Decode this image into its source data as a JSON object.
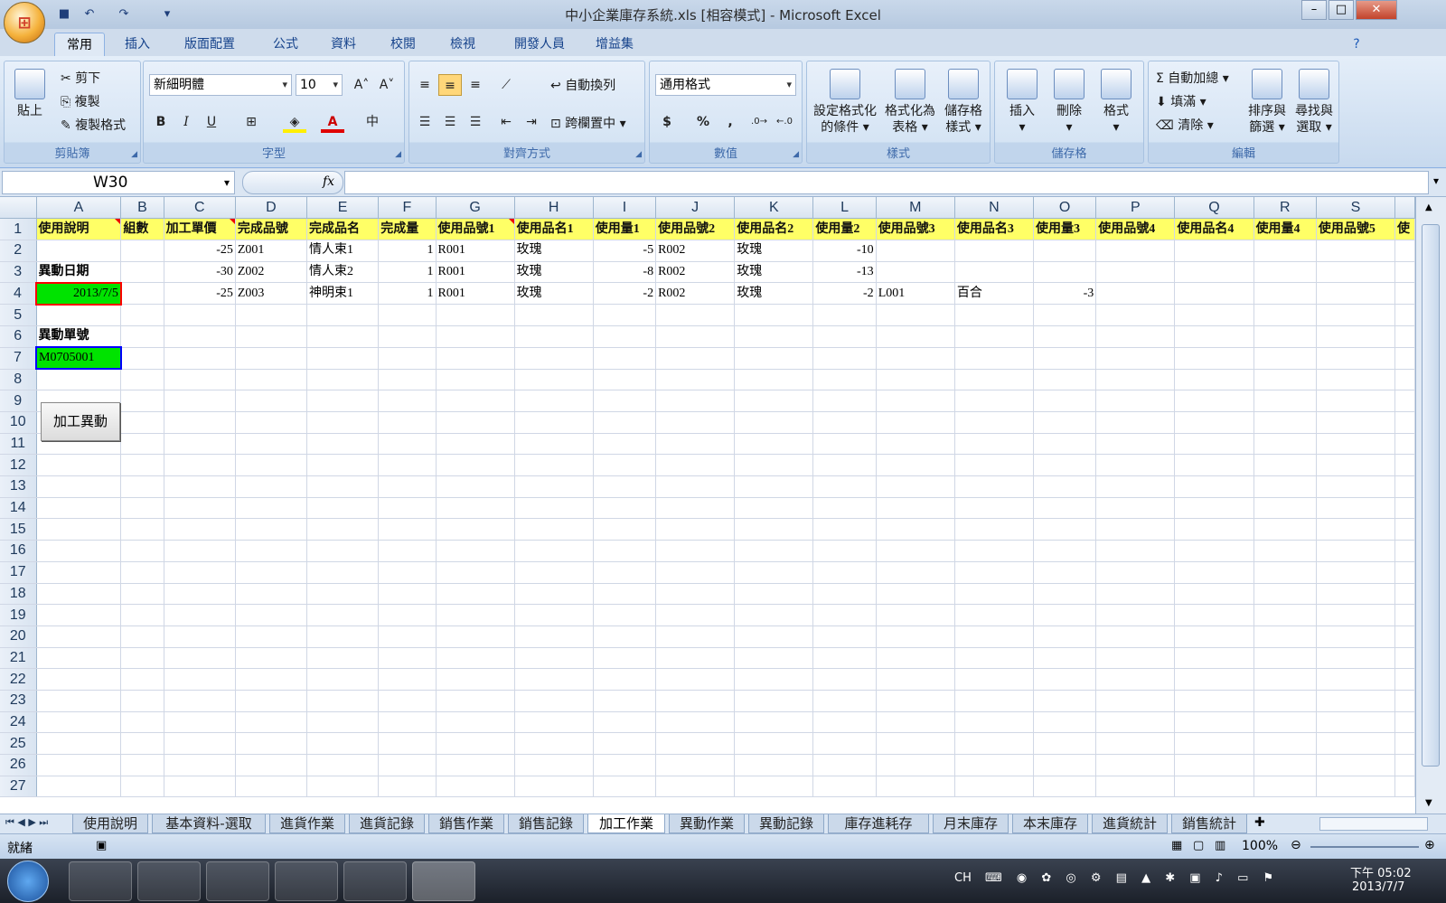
{
  "window": {
    "title": "中小企業庫存系統.xls [相容模式] - Microsoft Excel",
    "minimize": "–",
    "maximize": "□",
    "close": "✕"
  },
  "ribbon_tabs": [
    "常用",
    "插入",
    "版面配置",
    "公式",
    "資料",
    "校閱",
    "檢視",
    "開發人員",
    "增益集"
  ],
  "active_tab": "常用",
  "clipboard": {
    "paste": "貼上",
    "cut": "剪下",
    "copy": "複製",
    "format_painter": "複製格式",
    "label": "剪貼簿"
  },
  "font": {
    "name": "新細明體",
    "size": "10",
    "label": "字型",
    "bold": "B",
    "italic": "I",
    "underline": "U",
    "grow": "A˄",
    "shrink": "A˅",
    "color_letter": "A"
  },
  "alignment": {
    "wrap": "自動換列",
    "merge": "跨欄置中",
    "label": "對齊方式"
  },
  "number": {
    "format": "通用格式",
    "currency": "$",
    "percent": "%",
    "comma": ",",
    "label": "數值"
  },
  "styles": {
    "conditional": [
      "設定格式化",
      "的條件"
    ],
    "table": [
      "格式化為",
      "表格"
    ],
    "cell_styles": [
      "儲存格",
      "樣式"
    ],
    "label": "樣式"
  },
  "cells": {
    "insert": "插入",
    "delete": "刪除",
    "format": "格式",
    "label": "儲存格"
  },
  "editing": {
    "autosum": "自動加總",
    "fill": "填滿",
    "clear": "清除",
    "sort": [
      "排序與",
      "篩選"
    ],
    "find": [
      "尋找與",
      "選取"
    ],
    "label": "編輯"
  },
  "formula_bar": {
    "name_box": "W30",
    "fx": "fx",
    "content": ""
  },
  "columns": [
    "A",
    "B",
    "C",
    "D",
    "E",
    "F",
    "G",
    "H",
    "I",
    "J",
    "K",
    "L",
    "M",
    "N",
    "O",
    "P",
    "Q",
    "R",
    "S"
  ],
  "rows": {
    "r1": [
      "使用說明",
      "組數",
      "加工單價",
      "完成品號",
      "完成品名",
      "完成量",
      "使用品號1",
      "使用品名1",
      "使用量1",
      "使用品號2",
      "使用品名2",
      "使用量2",
      "使用品號3",
      "使用品名3",
      "使用量3",
      "使用品號4",
      "使用品名4",
      "使用量4",
      "使用品號5",
      "使"
    ],
    "r2": [
      "",
      "",
      "-25",
      "Z001",
      "情人束1",
      "1",
      "R001",
      "玫瑰",
      "-5",
      "R002",
      "玫瑰",
      "-10",
      "",
      "",
      "",
      "",
      "",
      "",
      "",
      ""
    ],
    "r3": [
      "異動日期",
      "",
      "-30",
      "Z002",
      "情人束2",
      "1",
      "R001",
      "玫瑰",
      "-8",
      "R002",
      "玫瑰",
      "-13",
      "",
      "",
      "",
      "",
      "",
      "",
      "",
      ""
    ],
    "r4": [
      "2013/7/5",
      "",
      "-25",
      "Z003",
      "神明束1",
      "1",
      "R001",
      "玫瑰",
      "-2",
      "R002",
      "玫瑰",
      "-2",
      "L001",
      "百合",
      "-3",
      "",
      "",
      "",
      "",
      ""
    ],
    "r6": [
      "異動單號"
    ],
    "r7": [
      "M0705001"
    ]
  },
  "row_numbers": [
    "1",
    "2",
    "3",
    "4",
    "5",
    "6",
    "7",
    "8",
    "9",
    "10",
    "11",
    "12",
    "13",
    "14",
    "15",
    "16",
    "17",
    "18",
    "19",
    "20",
    "21",
    "22",
    "23",
    "24",
    "25",
    "26",
    "27"
  ],
  "macro_button": "加工異動",
  "sheet_tabs": [
    "使用說明",
    "基本資料-選取",
    "進貨作業",
    "進貨記錄",
    "銷售作業",
    "銷售記錄",
    "加工作業",
    "異動作業",
    "異動記錄",
    "庫存進耗存",
    "月末庫存",
    "本末庫存",
    "進貨統計",
    "銷售統計"
  ],
  "active_sheet": "加工作業",
  "status": {
    "ready": "就緒",
    "zoom": "100%"
  },
  "taskbar": {
    "lang": "CH",
    "time": "下午 05:02",
    "date": "2013/7/7"
  }
}
